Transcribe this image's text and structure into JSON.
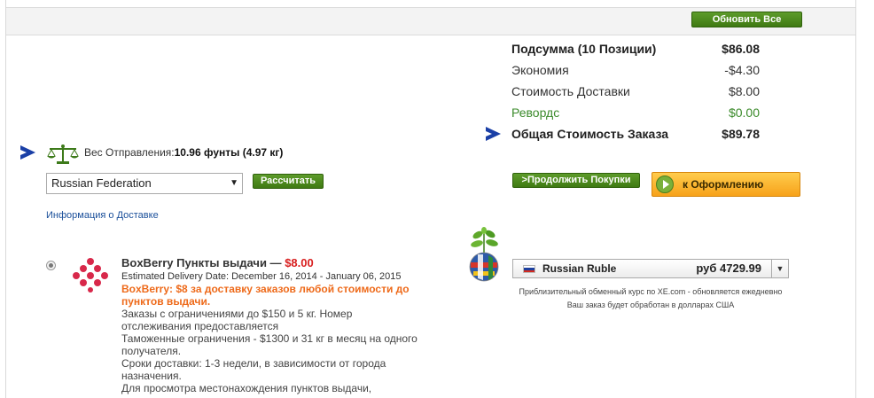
{
  "toolbar": {
    "update_all_label": "Обновить Все"
  },
  "summary": {
    "rows": [
      {
        "label": "Подсумма (10 Позиции)",
        "value": "$86.08"
      },
      {
        "label": "Экономия",
        "value": "-$4.30"
      },
      {
        "label": "Стоимость Доставки",
        "value": "$8.00"
      },
      {
        "label": "Ревордс",
        "value": "$0.00"
      },
      {
        "label": "Общая Стоимость Заказа",
        "value": "$89.78"
      }
    ]
  },
  "shipping": {
    "weight_label": "Вес Отправления:",
    "weight_value": "10.96 фунты (4.97 кг)",
    "country_selected": "Russian Federation",
    "calculate_label": "Рассчитать",
    "info_link": "Информация о Доставке"
  },
  "actions": {
    "continue_label": ">Продолжить Покупки",
    "checkout_label": "к Оформлению"
  },
  "carrier": {
    "name": "BoxBerry Пункты выдачи —",
    "price": "$8.00",
    "estimated": "Estimated Delivery Date: December 16, 2014 - January 06, 2015",
    "promo": "BoxBerry: $8 за доставку заказов любой стоимости до пунктов выдачи.",
    "desc1": "Заказы с ограничениями до $150 и 5 кг. Номер отслеживания предоставляется",
    "desc2": "Таможенные ограничения - $1300 и 31 кг в месяц на одного получателя.",
    "desc3": "Сроки доставки: 1-3 недели, в зависимости от города назначения.",
    "desc4": "Для просмотра местонахождения пунктов выдачи,"
  },
  "currency": {
    "name": "Russian Ruble",
    "amount": "руб 4729.99",
    "note1": "Приблизительный обменный курс по XE.com - обновляется ежедневно",
    "note2": "Ваш заказ будет обработан в долларах США"
  },
  "colors": {
    "accent_green": "#4a8a1e",
    "link_blue": "#1a4f9a",
    "price_red": "#d81e1e",
    "promo_orange": "#ee6a1a",
    "checkout_orange": "#f7a21a"
  }
}
